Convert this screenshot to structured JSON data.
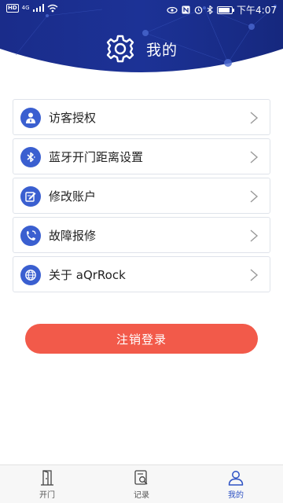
{
  "status_bar": {
    "hd": "HD",
    "network": "4G",
    "time": "下午4:07",
    "battery_level": 0.85
  },
  "header": {
    "title": "我的",
    "icon": "gear-icon",
    "bg_color": "#1c2f8f"
  },
  "menu": {
    "items": [
      {
        "label": "访客授权",
        "icon": "visitor-icon"
      },
      {
        "label": "蓝牙开门距离设置",
        "icon": "bluetooth-icon"
      },
      {
        "label": "修改账户",
        "icon": "edit-icon"
      },
      {
        "label": "故障报修",
        "icon": "repair-icon"
      },
      {
        "label": "关于 aQrRock",
        "icon": "globe-icon"
      }
    ],
    "icon_color": "#3a5fd0"
  },
  "logout": {
    "label": "注销登录",
    "color": "#f25a4a"
  },
  "tabbar": {
    "tabs": [
      {
        "label": "开门",
        "icon": "door-icon",
        "active": false
      },
      {
        "label": "记录",
        "icon": "records-icon",
        "active": false
      },
      {
        "label": "我的",
        "icon": "user-icon",
        "active": true
      }
    ],
    "active_color": "#2e52c4"
  }
}
